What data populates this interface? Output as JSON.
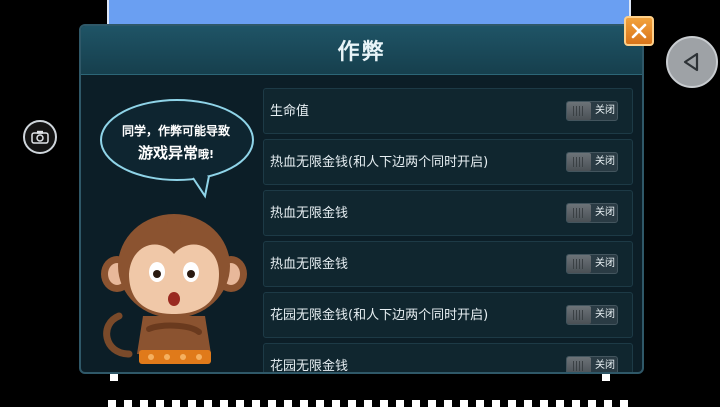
{
  "dialog": {
    "title": "作弊",
    "close_icon": "close-icon"
  },
  "speech_bubble": {
    "line1": "同学，作弊可能导致",
    "line2_main": "游戏异常",
    "line2_suffix": "哦!"
  },
  "cheats": [
    {
      "label": "生命值",
      "state": "关闭"
    },
    {
      "label": "热血无限金钱(和人下边两个同时开启)",
      "state": "关闭"
    },
    {
      "label": "热血无限金钱",
      "state": "关闭"
    },
    {
      "label": "热血无限金钱",
      "state": "关闭"
    },
    {
      "label": "花园无限金钱(和人下边两个同时开启)",
      "state": "关闭"
    },
    {
      "label": "花园无限金钱",
      "state": "关闭"
    }
  ],
  "side": {
    "camera_icon": "camera-icon",
    "back_icon": "back-triangle-icon"
  },
  "colors": {
    "close_button": "#e58a2a",
    "panel_bg": "#0c1e27",
    "header_bg": "#1f5466",
    "game_sky": "#6a9ff2"
  }
}
